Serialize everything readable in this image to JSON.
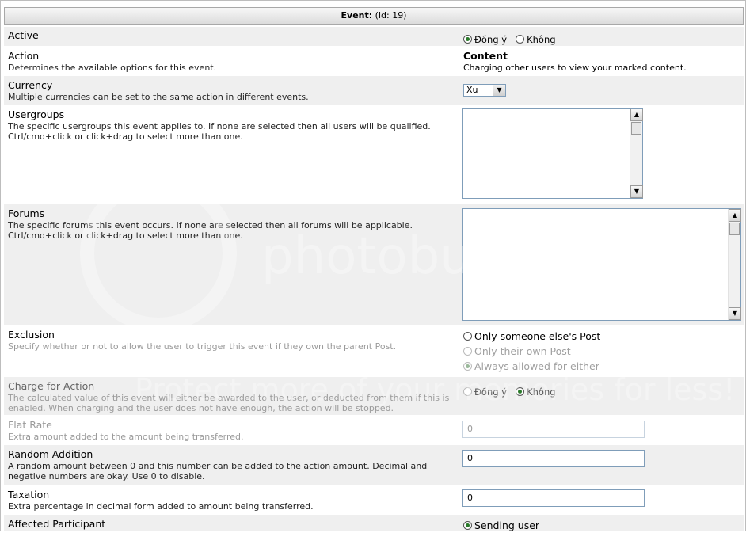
{
  "header": {
    "title": "Event:",
    "id_text": "(id: 19)"
  },
  "rows": {
    "active": {
      "label": "Active",
      "opt_yes": "Đồng ý",
      "opt_no": "Không"
    },
    "action": {
      "label": "Action",
      "desc": "Determines the available options for this event.",
      "value_title": "Content",
      "value_desc": "Charging other users to view your marked content."
    },
    "currency": {
      "label": "Currency",
      "desc": "Multiple currencies can be set to the same action in different events.",
      "selected": "Xu"
    },
    "usergroups": {
      "label": "Usergroups",
      "desc": "The specific usergroups this event applies to. If none are selected then all users will be qualified.\nCtrl/cmd+click or click+drag to select more than one."
    },
    "forums": {
      "label": "Forums",
      "desc": "The specific forums this event occurs. If none are selected then all forums will be applicable.\nCtrl/cmd+click or click+drag to select more than one."
    },
    "exclusion": {
      "label": "Exclusion",
      "desc": "Specify whether or not to allow the user to trigger this event if they own the parent Post.",
      "opt1": "Only someone else's Post",
      "opt2": "Only their own Post",
      "opt3": "Always allowed for either"
    },
    "charge": {
      "label": "Charge for Action",
      "desc": "The calculated value of this event will either be awarded to the user, or deducted from them if this is enabled. When charging and the user does not have enough, the action will be stopped.",
      "opt_yes": "Đồng ý",
      "opt_no": "Không"
    },
    "flat_rate": {
      "label": "Flat Rate",
      "desc": "Extra amount added to the amount being transferred.",
      "value": "0"
    },
    "random_addition": {
      "label": "Random Addition",
      "desc": "A random amount between 0 and this number can be added to the action amount. Decimal and negative numbers are okay. Use 0 to disable.",
      "value": "0"
    },
    "taxation": {
      "label": "Taxation",
      "desc": "Extra percentage in decimal form added to amount being transferred.",
      "value": "0"
    },
    "affected": {
      "label": "Affected Participant",
      "opt1": "Sending user"
    }
  },
  "watermark": {
    "text": "Protect more of your memories for less!",
    "brand": "photobucket"
  }
}
